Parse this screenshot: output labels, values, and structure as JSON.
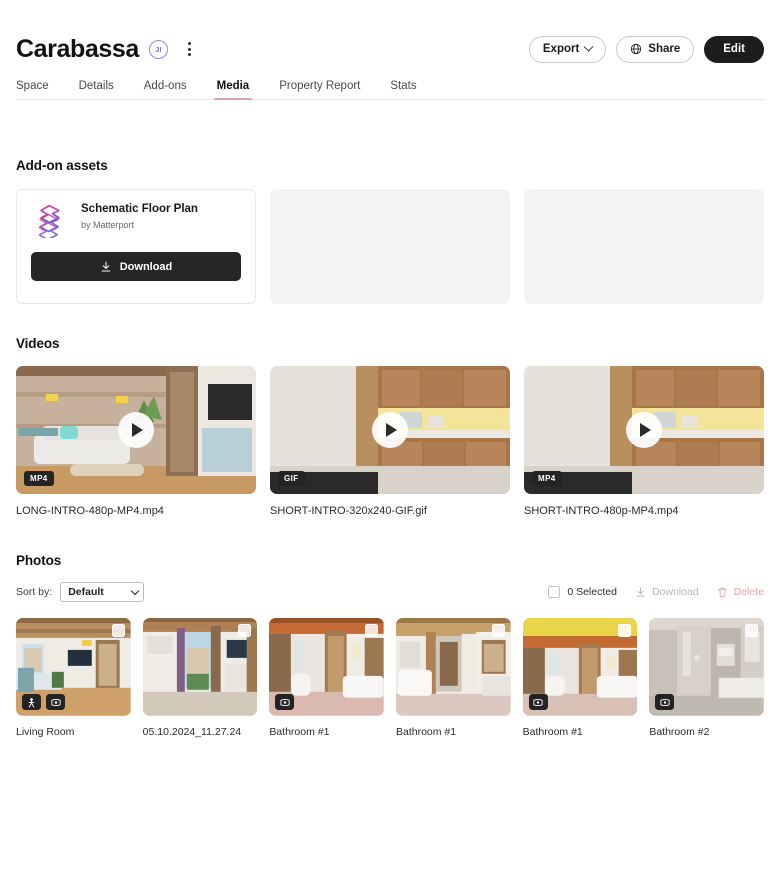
{
  "header": {
    "title": "Carabassa",
    "avatar_initials": "JI",
    "menu_icon": "kebab-menu-icon",
    "export_label": "Export",
    "share_label": "Share",
    "edit_label": "Edit"
  },
  "tabs": [
    {
      "label": "Space",
      "active": false
    },
    {
      "label": "Details",
      "active": false
    },
    {
      "label": "Add-ons",
      "active": false
    },
    {
      "label": "Media",
      "active": true
    },
    {
      "label": "Property Report",
      "active": false
    },
    {
      "label": "Stats",
      "active": false
    }
  ],
  "addons": {
    "section_title": "Add-on assets",
    "cards": [
      {
        "name": "Schematic Floor Plan",
        "by": "by Matterport",
        "download_label": "Download",
        "logo": "matterport-layers-logo",
        "placeholder": false
      },
      {
        "placeholder": true
      },
      {
        "placeholder": true
      }
    ]
  },
  "videos": {
    "section_title": "Videos",
    "items": [
      {
        "caption": "LONG-INTRO-480p-MP4.mp4",
        "format": "MP4"
      },
      {
        "caption": "SHORT-INTRO-320x240-GIF.gif",
        "format": "GIF"
      },
      {
        "caption": "SHORT-INTRO-480p-MP4.mp4",
        "format": "MP4"
      }
    ]
  },
  "photos": {
    "section_title": "Photos",
    "sort_label": "Sort by:",
    "sort_value": "Default",
    "sort_options": [
      "Default"
    ],
    "selected_text": "0 Selected",
    "download_label": "Download",
    "delete_label": "Delete",
    "items": [
      {
        "caption": "Living Room",
        "badges": [
          "tripod-icon",
          "panorama-icon"
        ]
      },
      {
        "caption": "05.10.2024_11.27.24",
        "badges": []
      },
      {
        "caption": "Bathroom #1",
        "badges": [
          "panorama-icon"
        ]
      },
      {
        "caption": "Bathroom #1",
        "badges": []
      },
      {
        "caption": "Bathroom #1",
        "badges": [
          "panorama-icon"
        ]
      },
      {
        "caption": "Bathroom #2",
        "badges": [
          "panorama-icon"
        ]
      }
    ]
  },
  "colors": {
    "accent_tab_underline": "#d9a3b5",
    "dark_button": "#1d1d1d",
    "delete_disabled": "#e6a6a6",
    "avatar_ring": "#8a8ce0"
  }
}
